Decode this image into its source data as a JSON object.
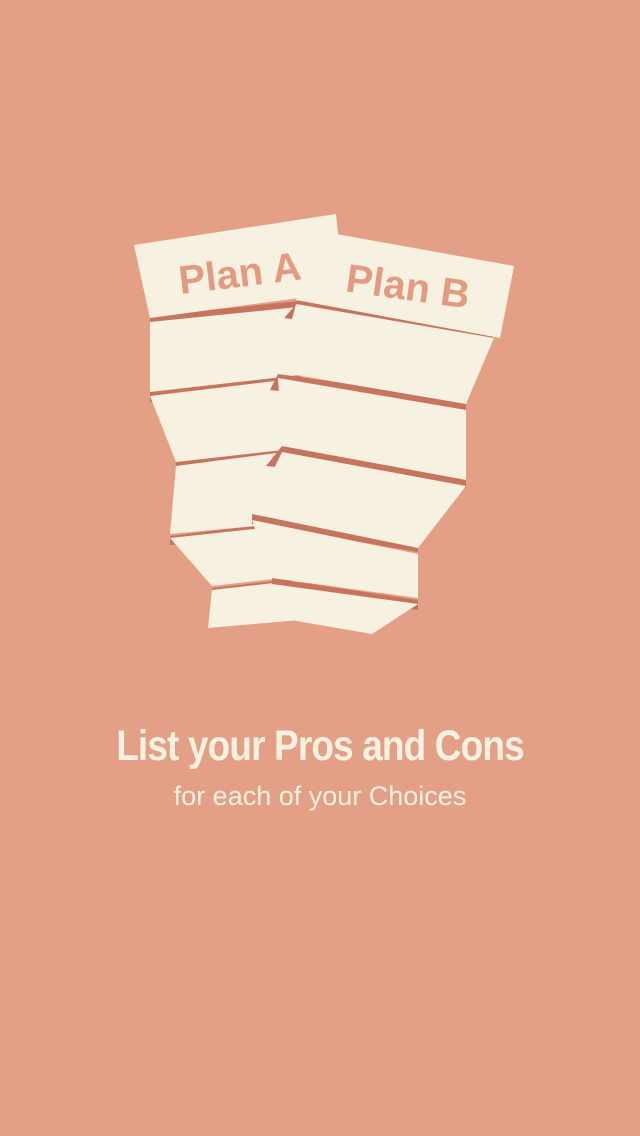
{
  "illustration": {
    "sheets": [
      {
        "label": "Plan A"
      },
      {
        "label": "Plan B"
      }
    ]
  },
  "onboarding": {
    "title": "List your Pros and Cons",
    "subtitle": "for each of your Choices"
  },
  "colors": {
    "background": "#e3a086",
    "paper": "#f7f1e1",
    "paper_shadow": "#c7745f",
    "label_text": "#e29b80"
  }
}
